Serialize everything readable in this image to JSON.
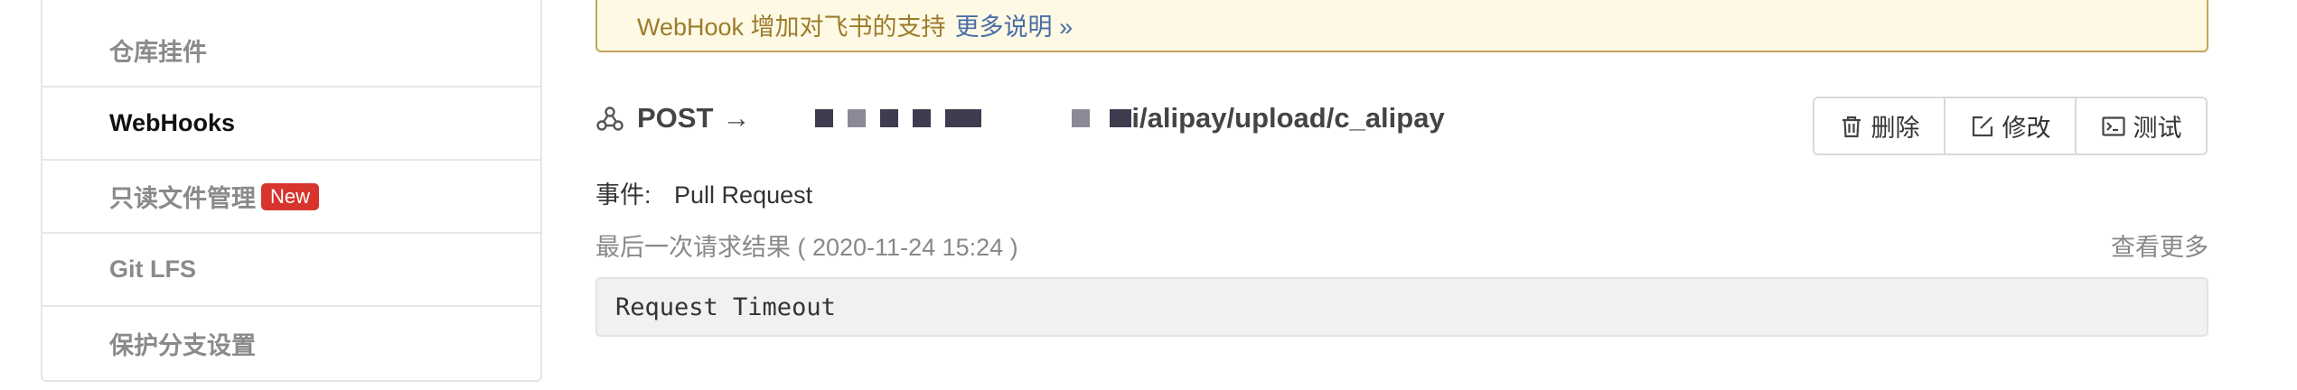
{
  "sidebar": {
    "items": [
      {
        "label": "仓库挂件",
        "active": false
      },
      {
        "label": "WebHooks",
        "active": true
      },
      {
        "label": "只读文件管理",
        "badge": "New",
        "active": false
      },
      {
        "label": "Git LFS",
        "active": false
      },
      {
        "label": "保护分支设置",
        "active": false
      }
    ]
  },
  "notice": {
    "text": "WebHook 增加对飞书的支持",
    "link": "更多说明 »"
  },
  "hook": {
    "method": "POST",
    "arrow": "→",
    "url_tail": "i/alipay/upload/c_alipay",
    "events_label": "事件:",
    "events_value": "Pull Request",
    "last_result_label": "最后一次请求结果 ( 2020-11-24 15:24 )",
    "see_more": "查看更多",
    "result_text": "Request Timeout"
  },
  "actions": {
    "delete": "删除",
    "edit": "修改",
    "test": "测试"
  },
  "colors": {
    "badge": "#d6342d",
    "notice_bg": "#fdf9e4",
    "notice_border": "#c4a65a",
    "link": "#4a6ea8"
  },
  "icons": {
    "webhook": "webhook-icon",
    "delete": "trash-icon",
    "edit": "edit-icon",
    "test": "terminal-icon"
  }
}
